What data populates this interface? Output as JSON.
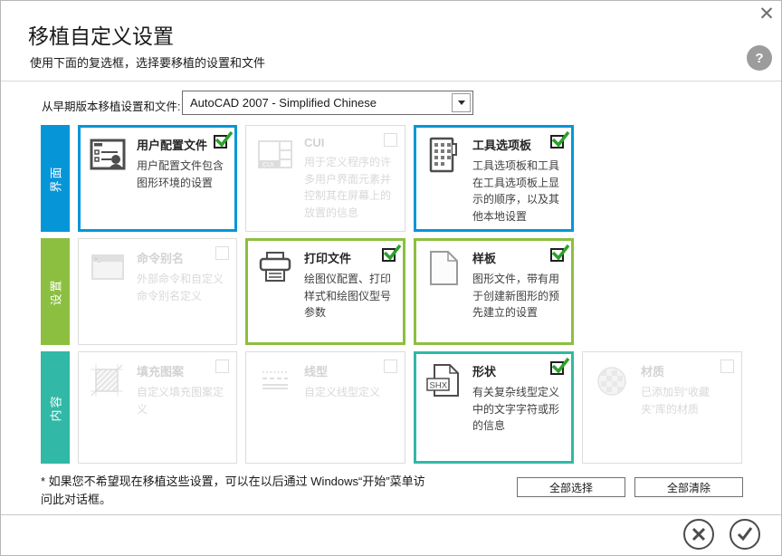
{
  "window": {
    "title": "移植自定义设置",
    "subtitle": "使用下面的复选框，选择要移植的设置和文件",
    "close_icon": "✕",
    "help_icon": "?"
  },
  "source_row": {
    "label": "从早期版本移植设置和文件:",
    "value": "AutoCAD 2007 - Simplified Chinese"
  },
  "categories": [
    {
      "label": "界面",
      "color": "#0696d7"
    },
    {
      "label": "设置",
      "color": "#8cbf3f"
    },
    {
      "label": "内容",
      "color": "#31b8a6"
    }
  ],
  "cards": [
    {
      "title": "用户配置文件",
      "desc": "用户配置文件包含图形环境的设置",
      "icon": "user-profile-icon",
      "checked": true,
      "enabled": true,
      "category": "界面"
    },
    {
      "title": "CUI",
      "desc": "用于定义程序的许多用户界面元素并控制其在屏幕上的放置的信息",
      "icon": "cui-icon",
      "checked": false,
      "enabled": false,
      "category": "界面"
    },
    {
      "title": "工具选项板",
      "desc": "工具选项板和工具在工具选项板上显示的顺序，以及其他本地设置",
      "icon": "tool-palette-icon",
      "checked": true,
      "enabled": true,
      "category": "界面"
    },
    {
      "title": "命令别名",
      "desc": "外部命令和自定义命令别名定义",
      "icon": "command-alias-icon",
      "checked": false,
      "enabled": false,
      "category": "设置"
    },
    {
      "title": "打印文件",
      "desc": "绘图仪配置、打印样式和绘图仪型号参数",
      "icon": "printer-icon",
      "checked": true,
      "enabled": true,
      "category": "设置"
    },
    {
      "title": "样板",
      "desc": "图形文件，带有用于创建新图形的预先建立的设置",
      "icon": "template-file-icon",
      "checked": true,
      "enabled": true,
      "category": "设置"
    },
    {
      "title": "填充图案",
      "desc": "自定义填充图案定义",
      "icon": "hatch-pattern-icon",
      "checked": false,
      "enabled": false,
      "category": "内容"
    },
    {
      "title": "线型",
      "desc": "自定义线型定义",
      "icon": "linetype-icon",
      "checked": false,
      "enabled": false,
      "category": "内容"
    },
    {
      "title": "形状",
      "desc": "有关复杂线型定义中的文字字符或形的信息",
      "icon": "shape-shx-icon",
      "checked": true,
      "enabled": true,
      "category": "内容"
    },
    {
      "title": "材质",
      "desc": "已添加到“收藏夹”库的材质",
      "icon": "material-icon",
      "checked": false,
      "enabled": false,
      "category": "内容"
    }
  ],
  "icon_labels": {
    "cui": "CUI",
    "shx": "SHX"
  },
  "footnote": {
    "line1": "* 如果您不希望现在移植这些设置，可以在以后通过 Windows“开始”菜单访",
    "line2": "问此对话框。"
  },
  "buttons": {
    "select_all": "全部选择",
    "clear_all": "全部清除"
  },
  "colors": {
    "interface_blue": "#0696d7",
    "settings_green": "#8cbf3f",
    "content_teal": "#31b8a6",
    "check_green": "#2da12c"
  }
}
